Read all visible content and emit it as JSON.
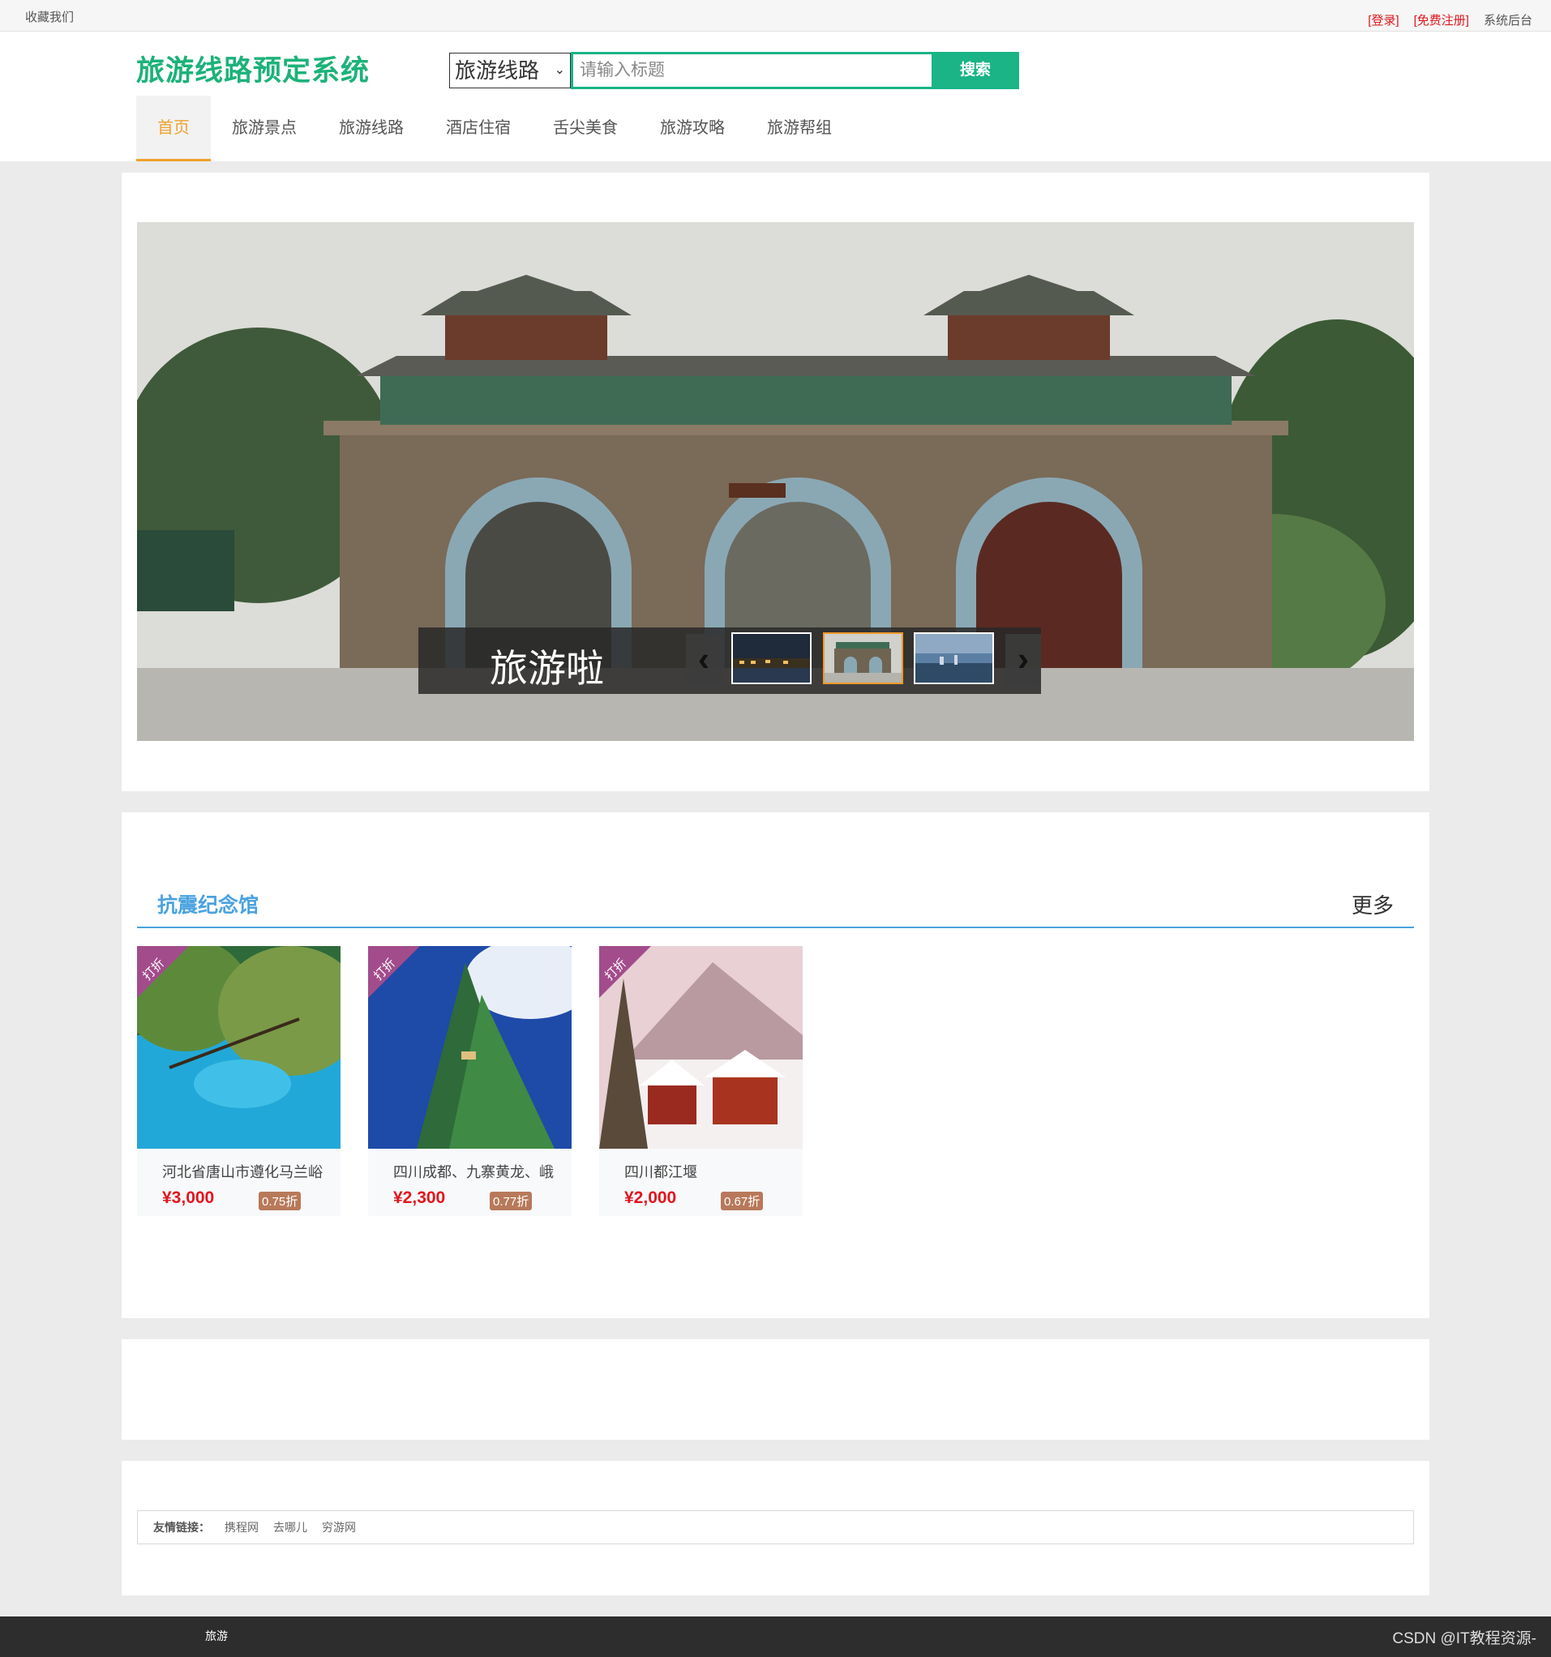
{
  "topbar": {
    "favorite": "收藏我们",
    "login": "[登录]",
    "register": "[免费注册]",
    "admin": "系统后台"
  },
  "header": {
    "logo": "旅游线路预定系统",
    "search": {
      "select_value": "旅游线路",
      "placeholder": "请输入标题",
      "button": "搜索"
    }
  },
  "nav": {
    "items": [
      "首页",
      "旅游景点",
      "旅游线路",
      "酒店住宿",
      "舌尖美食",
      "旅游攻略",
      "旅游帮组"
    ]
  },
  "banner": {
    "caption": "旅游啦",
    "prev_icon": "chevron-left-icon",
    "next_icon": "chevron-right-icon",
    "active_thumb": 2
  },
  "section": {
    "title": "抗震纪念馆",
    "more": "更多",
    "cards": [
      {
        "badge": "打折",
        "name": "河北省唐山市遵化马兰峪",
        "price": "¥3,000",
        "discount": "0.75折"
      },
      {
        "badge": "打折",
        "name": "四川成都、九寨黄龙、峨",
        "price": "¥2,300",
        "discount": "0.77折"
      },
      {
        "badge": "打折",
        "name": "四川都江堰",
        "price": "¥2,000",
        "discount": "0.67折"
      }
    ]
  },
  "friend_links": {
    "label": "友情链接：",
    "items": [
      "携程网",
      "去哪儿",
      "穷游网"
    ]
  },
  "footer": {
    "text": "旅游",
    "watermark": "CSDN @IT教程资源-"
  },
  "colors": {
    "accent_green": "#1ab486",
    "nav_active": "#f0a12c",
    "section_blue": "#4aa3df",
    "price_red": "#e0161e"
  }
}
